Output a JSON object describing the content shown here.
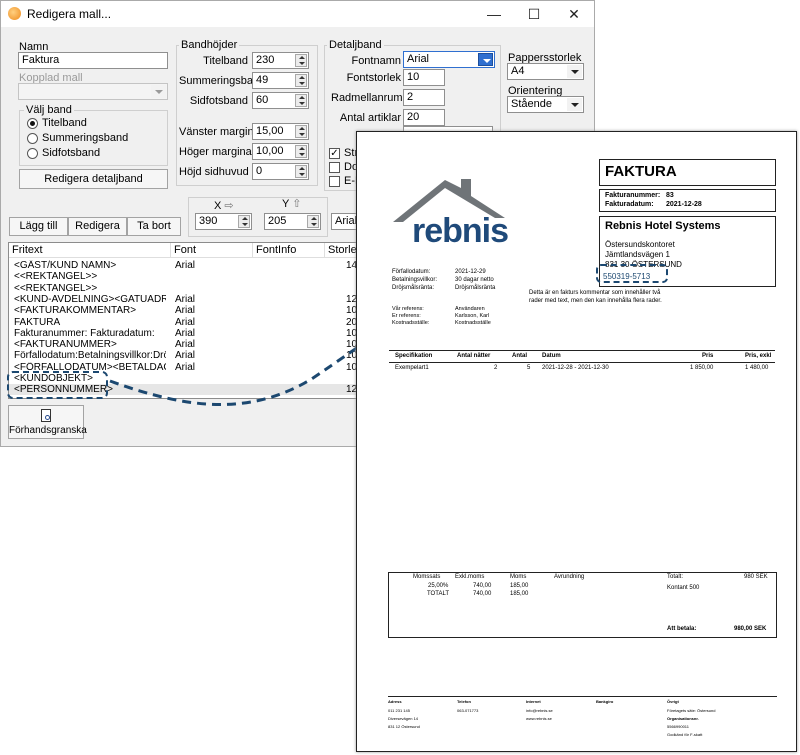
{
  "window": {
    "title": "Redigera mall...",
    "minimize_glyph": "—",
    "maximize_glyph": "☐",
    "close_glyph": "✕"
  },
  "left_panel": {
    "namn_label": "Namn",
    "namn_value": "Faktura",
    "kopplad_label": "Kopplad mall",
    "kopplad_value": "",
    "valj_band_label": "Välj band",
    "band_options": [
      "Titelband",
      "Summeringsband",
      "Sidfotsband"
    ],
    "selected_band": "Titelband",
    "edit_detail_button": "Redigera detaljband"
  },
  "bandhojder": {
    "label": "Bandhöjder",
    "fields": [
      {
        "label": "Titelband",
        "value": "230"
      },
      {
        "label": "Summeringsband",
        "value": "49"
      },
      {
        "label": "Sidfotsband",
        "value": "60"
      },
      {
        "label": "Vänster marginal",
        "value": "15,00"
      },
      {
        "label": "Höger marginal",
        "value": "10,00"
      },
      {
        "label": "Höjd sidhuvud",
        "value": "0"
      }
    ]
  },
  "detaljband": {
    "label": "Detaljband",
    "fontnamn_label": "Fontnamn",
    "fontnamn_value": "Arial",
    "fontstorlek_label": "Fontstorlek",
    "fontstorlek_value": "10",
    "radmellanrum_label": "Radmellanrum",
    "radmellanrum_value": "2",
    "antal_artiklar_label": "Antal artiklar",
    "antal_artiklar_value": "20",
    "checkbox_labels": [
      "Str",
      "Dol",
      "E-F"
    ]
  },
  "paper": {
    "size_label": "Pappersstorlek",
    "size_value": "A4",
    "orientation_label": "Orientering",
    "orientation_value": "Stående"
  },
  "toolbar": {
    "add": "Lägg till",
    "edit": "Redigera",
    "delete": "Ta bort",
    "x_label": "X",
    "y_label": "Y",
    "x_value": "390",
    "y_value": "205",
    "font_value": "Arial"
  },
  "list": {
    "headers": [
      "Fritext",
      "Font",
      "FontInfo",
      "Storlek"
    ],
    "rows": [
      {
        "text": "<GÄST/KUND NAMN>",
        "font": "Arial",
        "size": "14"
      },
      {
        "text": "<<REKTANGEL>>",
        "font": "",
        "size": ""
      },
      {
        "text": "<<REKTANGEL>>",
        "font": "",
        "size": ""
      },
      {
        "text": "<KUND-AVDELNING><GATUADR...",
        "font": "Arial",
        "size": "12"
      },
      {
        "text": "<FAKTURAKOMMENTAR>",
        "font": "Arial",
        "size": "10"
      },
      {
        "text": "FAKTURA",
        "font": "Arial",
        "size": "20"
      },
      {
        "text": "Fakturanummer:      Fakturadatum:",
        "font": "Arial",
        "size": "10"
      },
      {
        "text": "<FAKTURANUMMER>",
        "font": "Arial",
        "size": "10"
      },
      {
        "text": "Förfallodatum:Betalningsvillkor:Dröjs...",
        "font": "Arial",
        "size": "10"
      },
      {
        "text": "<FÖRFALLODATUM><BETALDAGA...",
        "font": "Arial",
        "size": "10"
      },
      {
        "text": "<KUNDOBJEKT>",
        "font": "",
        "size": ""
      },
      {
        "text": "<PERSONNUMMER>",
        "font": "",
        "size": "12"
      }
    ]
  },
  "preview_button": "Förhandsgranska",
  "invoice": {
    "title": "FAKTURA",
    "number_label": "Fakturanummer:",
    "number_value": "83",
    "date_label": "Fakturadatum:",
    "date_value": "2021-12-28",
    "company": "Rebnis Hotel Systems",
    "address_lines": [
      "Östersundskontoret",
      "Jämtlandsvägen 1",
      "831 30  ÖSTERSUND"
    ],
    "personnummer": "550319-5713",
    "logo_text": "rebnis",
    "terms_labels": [
      "Förfallodatum:",
      "Betalningsvillkor:",
      "Dröjsmålsränta:"
    ],
    "terms_values": [
      "2021-12-29",
      "30 dagar netto",
      "Dröjsmålsränta"
    ],
    "ref_labels": [
      "Vår referens:",
      "Er referens:",
      "Kostnadsställe:"
    ],
    "ref_values": [
      "Användaren",
      "Karlsson, Karl",
      "Kostnadsställe"
    ],
    "comment_lines": [
      "Detta är en fakturs kommentar som innehåller två",
      "rader med text, men den kan innehålla flera rader."
    ],
    "table_headers": [
      "Specifikation",
      "Antal nätter",
      "Antal",
      "Datum",
      "Pris",
      "Pris, exkl"
    ],
    "table_row": [
      "Exempelart1",
      "2",
      "5",
      "2021-12-28 - 2021-12-30",
      "1 850,00",
      "1 480,00"
    ],
    "summary": {
      "col_headers": [
        "Momssats",
        "Exkl.moms",
        "Moms",
        "Avrundning"
      ],
      "rows": [
        [
          "25,00%",
          "740,00",
          "185,00"
        ],
        [
          "TOTALT",
          "740,00",
          "185,00"
        ]
      ],
      "total_label": "Totalt:",
      "total_value": "980 SEK",
      "kontant": "Kontant 500",
      "pay_label": "Att betala:",
      "pay_value": "980,00 SEK"
    },
    "footer": {
      "headers": [
        "Adress",
        "Telefon",
        "Internet",
        "Bankgiro",
        "Övrigt"
      ],
      "col1": [
        "011 231 145",
        "Diversevägen 14",
        "831 12  Östersund"
      ],
      "col2": [
        "063-071773"
      ],
      "col3": [
        "info@rebnis.se",
        "www.rebnis.se"
      ],
      "col5": [
        "Företagets säte: Östersund",
        "Organisationsnr.",
        "5566990011",
        "Godkänd för F-skatt"
      ]
    }
  }
}
